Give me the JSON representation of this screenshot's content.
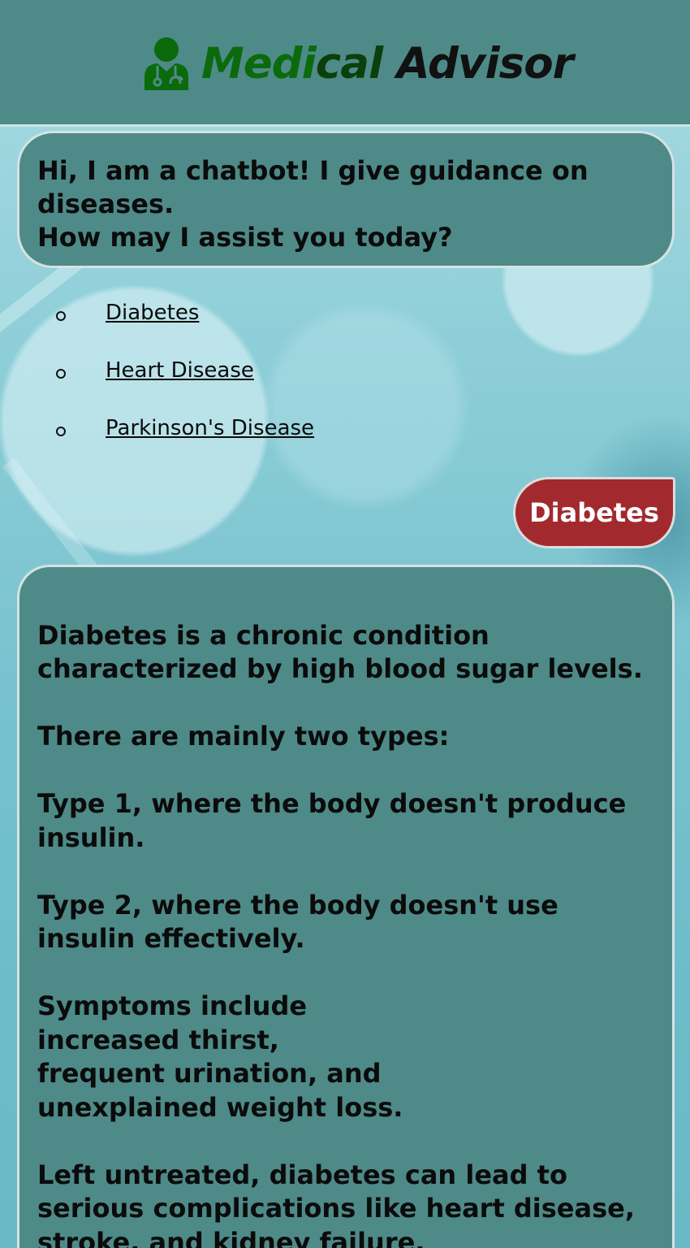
{
  "header": {
    "title_green": "Medi",
    "title_dark_green": "cal",
    "title_rest": " Advisor",
    "logo_icon": "doctor-stethoscope-icon"
  },
  "chat": {
    "greeting": "Hi, I am a chatbot! I give guidance on diseases.\nHow may I assist you today?",
    "options": [
      {
        "label": "Diabetes"
      },
      {
        "label": "Heart Disease"
      },
      {
        "label": "Parkinson's Disease"
      }
    ],
    "user_message": "Diabetes",
    "answer": "Diabetes is a chronic condition characterized by high blood sugar levels.\n\nThere are mainly two types:\n\nType 1, where the body doesn't produce insulin.\n\nType 2, where the body doesn't use insulin effectively.\n\nSymptoms include\nincreased thirst,\nfrequent urination, and\nunexplained weight loss.\n\nLeft untreated, diabetes can lead to serious complications like heart disease, stroke, and kidney failure."
  },
  "colors": {
    "header_bg": "#4e8a88",
    "bubble_bg": "#4e8a88",
    "user_bubble_bg": "#a22a2e",
    "brand_green": "#0b6a0b"
  }
}
